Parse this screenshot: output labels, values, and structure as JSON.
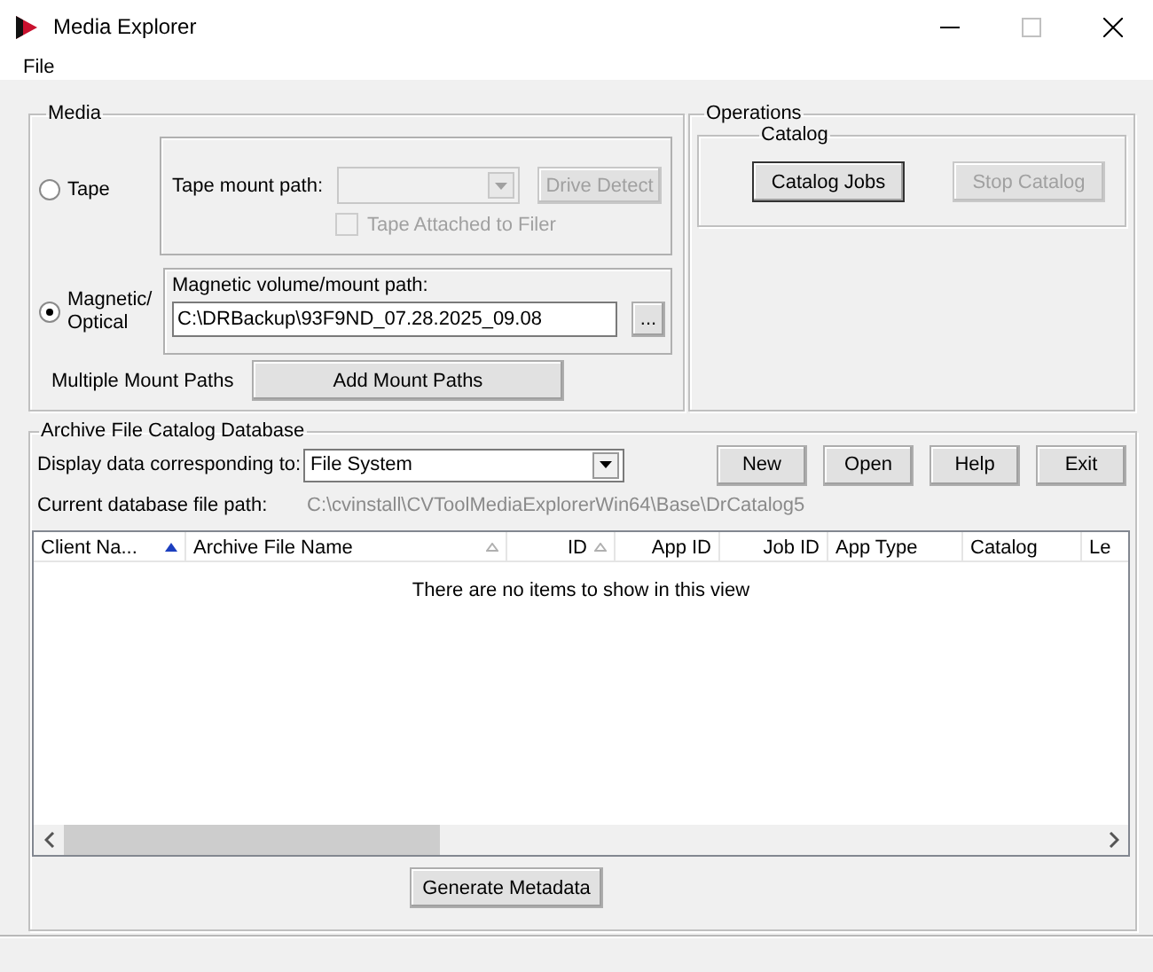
{
  "window": {
    "title": "Media Explorer"
  },
  "menu": [
    "File"
  ],
  "media": {
    "title": "Media",
    "options": [
      {
        "label": "Tape",
        "selected": false
      },
      {
        "label": "Magnetic/ Optical",
        "selected": true
      }
    ],
    "tape": {
      "mount_label": "Tape mount path:",
      "mount_combo": {
        "disabled": true
      },
      "drive_detect": {
        "label": "Drive Detect",
        "disabled": true
      },
      "attached": {
        "label": "Tape Attached to Filer",
        "checked": false,
        "disabled": true
      }
    },
    "magnetic": {
      "label": "Magnetic volume/mount path:",
      "value": "C:\\DRBackup\\93F9ND_07.28.2025_09.08",
      "browse": "..."
    },
    "multiple": {
      "label": "Multiple Mount Paths",
      "button": "Add Mount Paths"
    }
  },
  "operations": {
    "title": "Operations",
    "catalog": {
      "title": "Catalog",
      "buttons": [
        {
          "label": "Catalog Jobs",
          "disabled": false
        },
        {
          "label": "Stop Catalog",
          "disabled": true
        }
      ]
    }
  },
  "archive": {
    "title": "Archive File Catalog Database",
    "display_label": "Display data corresponding to:",
    "display_value": "File System",
    "buttons": [
      "New",
      "Open",
      "Help",
      "Exit"
    ],
    "path_label": "Current database file path:",
    "path_value": "C:\\cvinstall\\CVToolMediaExplorerWin64\\Base\\DrCatalog5",
    "columns": [
      {
        "label": "Client Na...",
        "align_right": false,
        "sort_arrow": true,
        "sort_active": true
      },
      {
        "label": "Archive File Name",
        "align_right": false,
        "sort_arrow": true,
        "sort_active": false
      },
      {
        "label": "ID",
        "align_right": true,
        "sort_arrow": true,
        "sort_active": false
      },
      {
        "label": "App ID",
        "align_right": true,
        "sort_arrow": false,
        "sort_active": false
      },
      {
        "label": "Job ID",
        "align_right": true,
        "sort_arrow": false,
        "sort_active": false
      },
      {
        "label": "App Type",
        "align_right": false,
        "sort_arrow": false,
        "sort_active": false
      },
      {
        "label": "Catalog",
        "align_right": false,
        "sort_arrow": false,
        "sort_active": false
      },
      {
        "label": "Le",
        "align_right": false,
        "sort_arrow": false,
        "sort_active": false
      }
    ],
    "empty_message": "There are no items to show in this view",
    "generate": "Generate Metadata"
  }
}
